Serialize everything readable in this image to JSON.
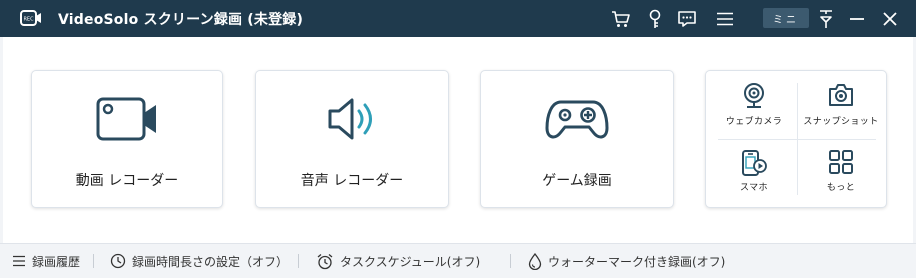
{
  "app": {
    "title": "VideoSolo スクリーン録画 (未登録)",
    "logo_icon": "rec-camera-icon"
  },
  "titlebar": {
    "icons": [
      "cart-icon",
      "key-icon",
      "chat-icon",
      "menu-icon",
      "pin-icon",
      "minimize-icon",
      "close-icon"
    ],
    "chip_text": "ミニ"
  },
  "cards": [
    {
      "label": "動画 レコーダー",
      "icon": "video-camera-icon"
    },
    {
      "label": "音声 レコーダー",
      "icon": "speaker-icon"
    },
    {
      "label": "ゲーム録画",
      "icon": "gamepad-icon"
    }
  ],
  "more_card": {
    "items": [
      {
        "label": "ウェブカメラ",
        "icon": "webcam-icon"
      },
      {
        "label": "スナップショット",
        "icon": "snapshot-camera-icon"
      },
      {
        "label": "スマホ",
        "icon": "phone-icon"
      },
      {
        "label": "もっと",
        "icon": "grid-icon"
      }
    ]
  },
  "bottombar": {
    "history": "録画履歴",
    "timer": "録画時間長さの設定（オフ）",
    "schedule": "タスクスケジュール(オフ)",
    "watermark": "ウォーターマーク付き録画(オフ)"
  },
  "colors": {
    "titlebar": "#1f3a4d",
    "icon_accent": "#2a4a5e",
    "background": "#f2f4f7"
  }
}
